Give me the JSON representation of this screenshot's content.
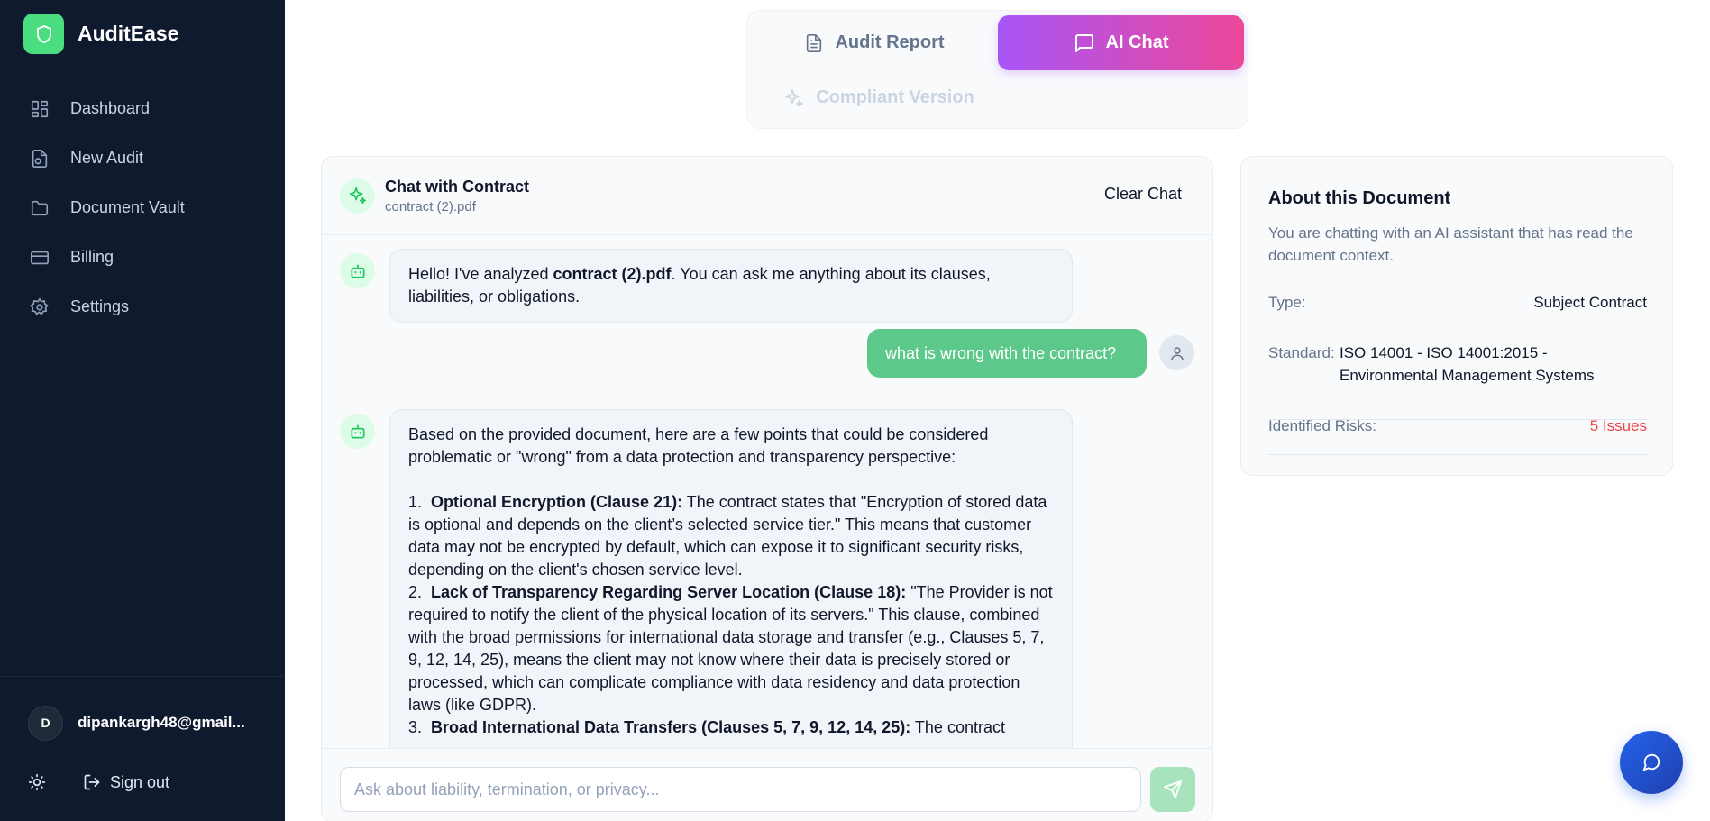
{
  "brand": {
    "name": "AuditEase"
  },
  "sidebar": {
    "items": [
      {
        "label": "Dashboard",
        "icon": "dashboard-icon"
      },
      {
        "label": "New Audit",
        "icon": "file-plus-icon"
      },
      {
        "label": "Document Vault",
        "icon": "folder-icon"
      },
      {
        "label": "Billing",
        "icon": "credit-card-icon"
      },
      {
        "label": "Settings",
        "icon": "gear-icon"
      }
    ],
    "user": {
      "initial": "D",
      "email": "dipankargh48@gmail..."
    },
    "sign_out": "Sign out"
  },
  "tabs": {
    "audit_report": "Audit Report",
    "ai_chat": "AI Chat",
    "compliant_version": "Compliant Version",
    "active": "ai_chat"
  },
  "chat": {
    "title": "Chat with Contract",
    "file": "contract (2).pdf",
    "clear_label": "Clear Chat",
    "greeting": {
      "prefix": "Hello! I've analyzed ",
      "file": "contract (2).pdf",
      "suffix": ". You can ask me anything about its clauses, liabilities, or obligations."
    },
    "user_message": "what is wrong with the contract?",
    "response": {
      "intro": "Based on the provided document, here are a few points that could be considered problematic or \"wrong\" from a data protection and transparency perspective:",
      "points": [
        {
          "num": "1.",
          "title": "Optional Encryption (Clause 21):",
          "text": " The contract states that \"Encryption of stored data is optional and depends on the client’s selected service tier.\" This means that customer data may not be encrypted by default, which can expose it to significant security risks, depending on the client's chosen service level."
        },
        {
          "num": "2.",
          "title": "Lack of Transparency Regarding Server Location (Clause 18):",
          "text": " \"The Provider is not required to notify the client of the physical location of its servers.\" This clause, combined with the broad permissions for international data storage and transfer (e.g., Clauses 5, 7, 9, 12, 14, 25), means the client may not know where their data is precisely stored or processed, which can complicate compliance with data residency and data protection laws (like GDPR)."
        },
        {
          "num": "3.",
          "title": "Broad International Data Transfers (Clauses 5, 7, 9, 12, 14, 25):",
          "text": " The contract"
        }
      ]
    },
    "input_placeholder": "Ask about liability, termination, or privacy..."
  },
  "about": {
    "title": "About this Document",
    "description": "You are chatting with an AI assistant that has read the document context.",
    "type_label": "Type:",
    "type_value": "Subject Contract",
    "standard_label": "Standard:",
    "standard_value": "ISO 14001 - ISO 14001:2015 - Environmental Management Systems",
    "risks_label": "Identified Risks:",
    "risks_value": "5 Issues"
  },
  "colors": {
    "sidebar_bg": "#0f1a2e",
    "brand_accent": "#4ade80",
    "chat_tab_gradient_start": "#a855f7",
    "chat_tab_gradient_end": "#ec4899",
    "user_bubble": "#5cc98a",
    "risk_text": "#ef4444",
    "fab": "#2563eb"
  }
}
